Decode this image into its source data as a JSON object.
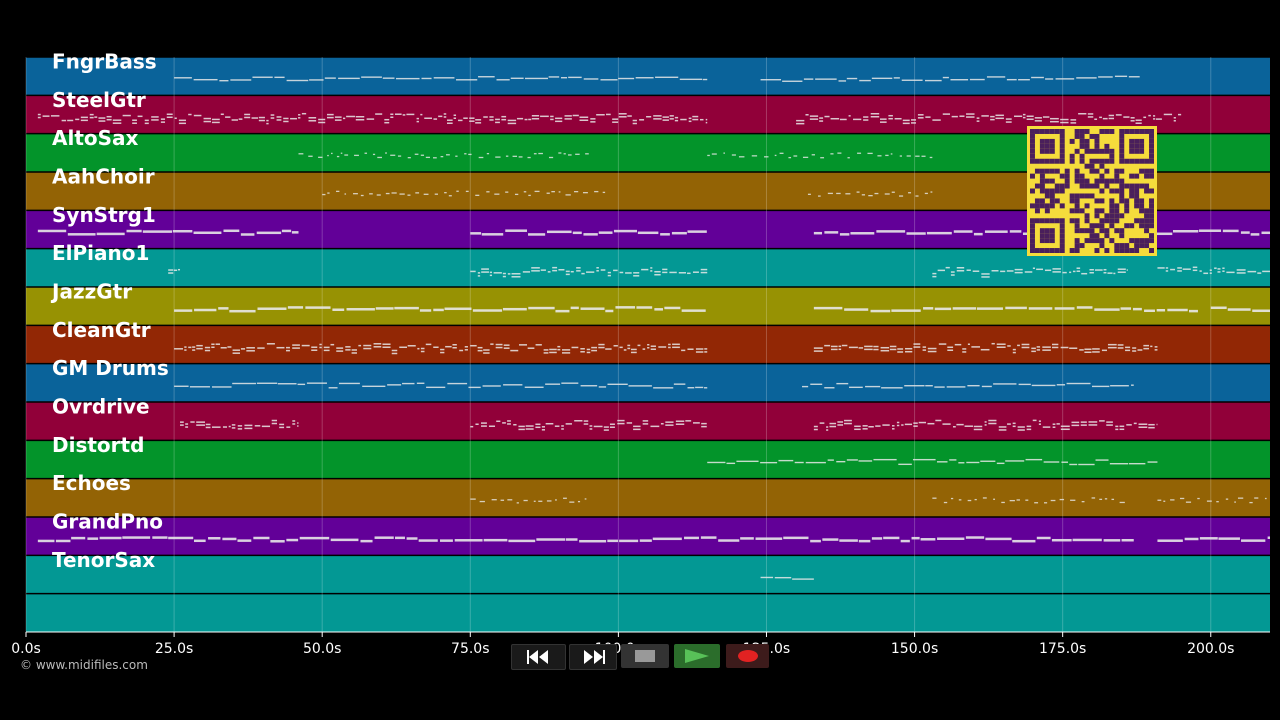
{
  "timeline": {
    "duration_seconds": 210,
    "ticks": [
      {
        "t": 0,
        "label": "0.0s"
      },
      {
        "t": 25,
        "label": "25.0s"
      },
      {
        "t": 50,
        "label": "50.0s"
      },
      {
        "t": 75,
        "label": "75.0s"
      },
      {
        "t": 100,
        "label": "100.0s"
      },
      {
        "t": 125,
        "label": "125.0s"
      },
      {
        "t": 150,
        "label": "150.0s"
      },
      {
        "t": 175,
        "label": "175.0s"
      },
      {
        "t": 200,
        "label": "200.0s"
      }
    ]
  },
  "tracks": [
    {
      "name": "FngrBass",
      "color": "#0a639a",
      "style": "line",
      "segments": [
        [
          25,
          115
        ],
        [
          124,
          188
        ]
      ]
    },
    {
      "name": "SteelGtr",
      "color": "#910039",
      "style": "dense",
      "segments": [
        [
          2,
          115
        ],
        [
          130,
          195
        ]
      ]
    },
    {
      "name": "AltoSax",
      "color": "#03942a",
      "style": "sparse",
      "segments": [
        [
          46,
          95
        ],
        [
          115,
          153
        ]
      ]
    },
    {
      "name": "AahChoir",
      "color": "#936305",
      "style": "sparse",
      "segments": [
        [
          50,
          98
        ],
        [
          132,
          153
        ]
      ]
    },
    {
      "name": "SynStrg1",
      "color": "#620098",
      "style": "thick",
      "segments": [
        [
          2,
          46
        ],
        [
          75,
          115
        ],
        [
          133,
          210
        ]
      ]
    },
    {
      "name": "ElPiano1",
      "color": "#039894",
      "style": "dense",
      "segments": [
        [
          24,
          26
        ],
        [
          75,
          115
        ],
        [
          153,
          186
        ],
        [
          191,
          210
        ]
      ]
    },
    {
      "name": "JazzGtr",
      "color": "#979203",
      "style": "thick",
      "segments": [
        [
          25,
          115
        ],
        [
          133,
          198
        ],
        [
          200,
          210
        ]
      ]
    },
    {
      "name": "CleanGtr",
      "color": "#922705",
      "style": "dense",
      "segments": [
        [
          25,
          115
        ],
        [
          133,
          191
        ]
      ]
    },
    {
      "name": "GM Drums",
      "color": "#0a639a",
      "style": "line",
      "segments": [
        [
          25,
          115
        ],
        [
          131,
          187
        ]
      ]
    },
    {
      "name": "Ovrdrive",
      "color": "#910039",
      "style": "dense",
      "segments": [
        [
          26,
          46
        ],
        [
          75,
          115
        ],
        [
          133,
          191
        ]
      ]
    },
    {
      "name": "Distortd",
      "color": "#03942a",
      "style": "line",
      "segments": [
        [
          115,
          191
        ]
      ]
    },
    {
      "name": "Echoes",
      "color": "#936305",
      "style": "sparse",
      "segments": [
        [
          75,
          95
        ],
        [
          153,
          186
        ],
        [
          191,
          210
        ]
      ]
    },
    {
      "name": "GrandPno",
      "color": "#620098",
      "style": "thick",
      "segments": [
        [
          2,
          187
        ],
        [
          191,
          210
        ]
      ]
    },
    {
      "name": "TenorSax",
      "color": "#039894",
      "style": "line",
      "segments": [
        [
          124,
          133
        ]
      ]
    },
    {
      "name": "",
      "color": "#039894",
      "style": "none",
      "segments": []
    }
  ],
  "copyright": "© www.midifiles.com",
  "transport": {
    "rewind_icon": "rewind-icon",
    "fast_forward_icon": "fast-forward-icon",
    "stop_icon": "stop-icon",
    "play_icon": "play-icon",
    "record_icon": "record-icon",
    "colors": {
      "stop": "#999999",
      "play": "#58c158",
      "record": "#e22222"
    }
  },
  "qr_code": {
    "foreground": "#4a1f5c",
    "background": "#f5dc3c"
  }
}
